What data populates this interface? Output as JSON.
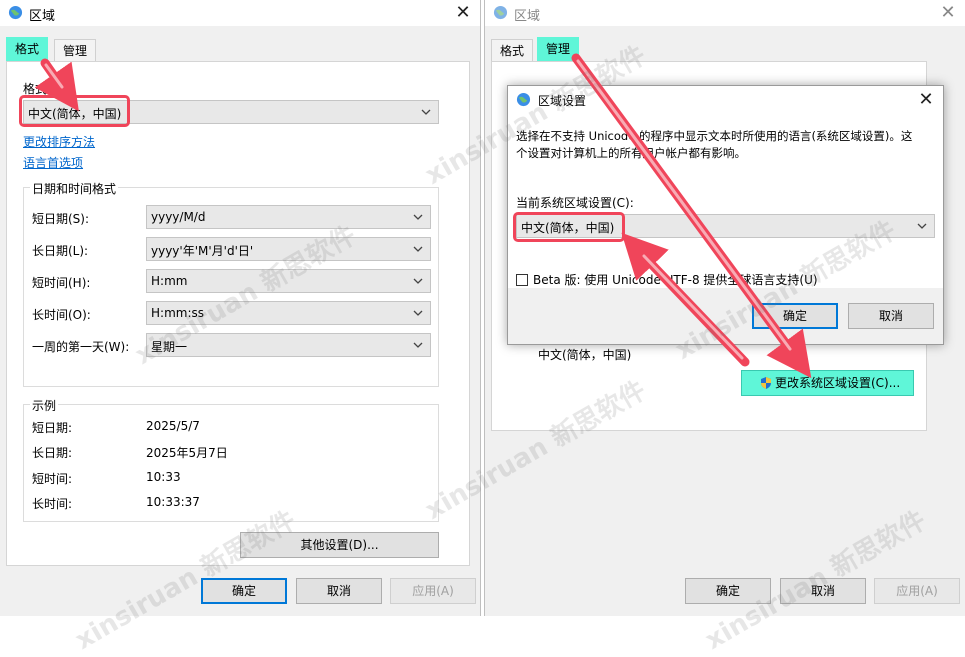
{
  "left": {
    "title": "区域",
    "tabs": [
      "格式",
      "管理"
    ],
    "format_label": "格式(F):",
    "format_value": "中文(简体，中国)",
    "links": [
      "更改排序方法",
      "语言首选项"
    ],
    "datetime_group": "日期和时间格式",
    "rows": [
      {
        "label": "短日期(S):",
        "value": "yyyy/M/d"
      },
      {
        "label": "长日期(L):",
        "value": "yyyy'年'M'月'd'日'"
      },
      {
        "label": "短时间(H):",
        "value": "H:mm"
      },
      {
        "label": "长时间(O):",
        "value": "H:mm:ss"
      },
      {
        "label": "一周的第一天(W):",
        "value": "星期一"
      }
    ],
    "example_group": "示例",
    "examples": [
      {
        "label": "短日期:",
        "value": "2025/5/7"
      },
      {
        "label": "长日期:",
        "value": "2025年5月7日"
      },
      {
        "label": "短时间:",
        "value": "10:33"
      },
      {
        "label": "长时间:",
        "value": "10:33:37"
      }
    ],
    "other_settings": "其他设置(D)...",
    "ok": "确定",
    "cancel": "取消",
    "apply": "应用(A)"
  },
  "right": {
    "title": "区域",
    "tabs": [
      "格式",
      "管理"
    ],
    "current_locale_text": "中文(简体，中国)",
    "change_locale_button": "更改系统区域设置(C)...",
    "ok": "确定",
    "cancel": "取消",
    "apply": "应用(A)"
  },
  "dialog": {
    "title": "区域设置",
    "description_line1": "选择在不支持 Unicode 的程序中显示文本时所使用的语言(系统区域设置)。这",
    "description_line2": "个设置对计算机上的所有用户帐户都有影响。",
    "current_label": "当前系统区域设置(C):",
    "current_value": "中文(简体，中国)",
    "beta_label": "Beta 版: 使用 Unicode UTF-8 提供全球语言支持(U)",
    "ok": "确定",
    "cancel": "取消"
  },
  "colors": {
    "highlight_cyan": "#5ff6d8",
    "annotation_red": "#f0455a",
    "link_blue": "#0066cc"
  },
  "icons": [
    "globe-icon",
    "close-icon",
    "chevron-down-icon",
    "shield-icon",
    "red-arrow-annotation"
  ]
}
